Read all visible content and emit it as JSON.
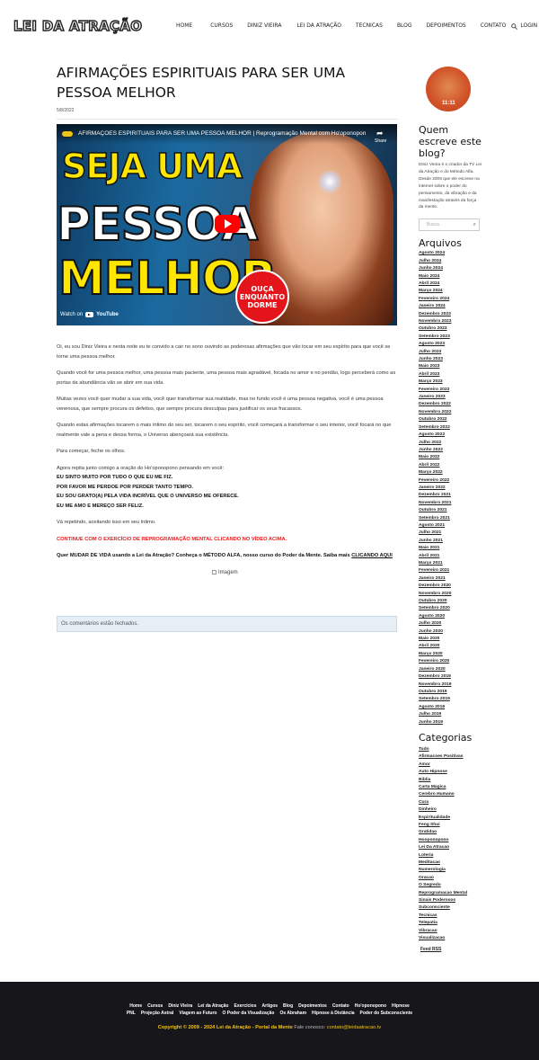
{
  "header": {
    "logo": "LEI DA ATRAÇÃO",
    "nav": [
      "HOME",
      "CURSOS",
      "DINIZ VIEIRA",
      "LEI DA ATRAÇÃO",
      "TECNICAS",
      "BLOG",
      "DEPOIMENTOS",
      "CONTATO",
      "LOGIN"
    ]
  },
  "post": {
    "title": "AFIRMAÇÕES ESPIRITUAIS PARA SER UMA PESSOA MELHOR",
    "date": "5/8/2022",
    "video": {
      "title": "AFIRMAÇÕES ESPIRITUAIS PARA SER UMA PESSOA MELHOR | Reprogramação Mental com Ho'oponopono ...",
      "share": "Share",
      "line1": "SEJA UMA",
      "line2": "PESSOA",
      "line3": "MELHOR",
      "badge1": "OUÇA",
      "badge2": "ENQUANTO",
      "badge3": "DORME",
      "watch_on": "Watch on",
      "youtube": "YouTube"
    },
    "paragraphs": [
      "Oi, eu sou Diniz Vieira e nesta noite eu te convido a cair no sono ouvindo as poderosas afirmações que vão tocar em seu espírito para que você se torne uma pessoa melhor.",
      "Quando você for uma pessoa melhor, uma pessoa mais paciente, uma pessoa mais agradável, focada no amor e no perdão, logo perceberá como as portas da abundância vão se abrir em sua vida.",
      "Muitas vezes você quer mudar a sua vida, você quer transformar sua realidade, mas no fundo você é uma pessoa negativa, você é uma pessoa venenosa, que sempre procura os defeitos, que sempre procura desculpas para justificar os seus fracassos.",
      "Quando estas afirmações tocarem o mais íntimo do seu ser, tocarem o seu espírito, você começará a transformar o seu interior, você focará no que realmente vale a pena e dessa forma, o Universo abençoará sua existência.",
      "Para começar, feche os olhos."
    ],
    "prayer_intro": "Agora repita junto comigo a oração do Ho'oponopono pensando em você:",
    "prayer": [
      "EU SINTO MUITO POR TUDO O QUE EU ME FIZ.",
      "POR FAVOR ME PERDOE POR PERDER TANTO TEMPO.",
      "EU SOU GRATO(A) PELA VIDA INCRÍVEL QUE O UNIVERSO ME OFERECE.",
      "EU ME AMO E MEREÇO SER FELIZ."
    ],
    "repeat": "Vá repetindo, aceitando isso em seu íntimo.",
    "continue": "CONTINUE COM O EXERCÍCIO DE REPROGRAMAÇÃO MENTAL CLICANDO NO VÍDEO ACIMA.",
    "cta_text": "Quer MUDAR DE VIDA usando a Lei da Atração? Conheça o MÉTODO ALFA, nosso curso do Poder da Mente. Saiba mais",
    "cta_link": "CLICANDO AQUI",
    "image_alt": "Imagem",
    "comments_closed": "Os comentários estão fechados."
  },
  "sidebar": {
    "avatar_text": "11:11",
    "about_title": "Quem escreve este blog?",
    "about_text": "Diniz Vieira é o criador da TV Lei da Atração e do Método Alfa. Desde 2009 que ele escreve na internet sobre o poder do pensamento, da vibração e da manifestação através da força da mente.",
    "search_placeholder": "Busca",
    "archives_title": "Arquivos",
    "archives": [
      "Agosto 2024",
      "Julho 2024",
      "Junho 2024",
      "Maio 2024",
      "Abril 2024",
      "Março 2024",
      "Fevereiro 2024",
      "Janeiro 2024",
      "Dezembro 2023",
      "Novembro 2023",
      "Outubro 2023",
      "Setembro 2023",
      "Agosto 2023",
      "Julho 2023",
      "Junho 2023",
      "Maio 2023",
      "Abril 2023",
      "Março 2023",
      "Fevereiro 2023",
      "Janeiro 2023",
      "Dezembro 2022",
      "Novembro 2022",
      "Outubro 2022",
      "Setembro 2022",
      "Agosto 2022",
      "Julho 2022",
      "Junho 2022",
      "Maio 2022",
      "Abril 2022",
      "Março 2022",
      "Fevereiro 2022",
      "Janeiro 2022",
      "Dezembro 2021",
      "Novembro 2021",
      "Outubro 2021",
      "Setembro 2021",
      "Agosto 2021",
      "Julho 2021",
      "Junho 2021",
      "Maio 2021",
      "Abril 2021",
      "Março 2021",
      "Fevereiro 2021",
      "Janeiro 2021",
      "Dezembro 2020",
      "Novembro 2020",
      "Outubro 2020",
      "Setembro 2020",
      "Agosto 2020",
      "Julho 2020",
      "Junho 2020",
      "Maio 2020",
      "Abril 2020",
      "Março 2020",
      "Fevereiro 2020",
      "Janeiro 2020",
      "Dezembro 2019",
      "Novembro 2019",
      "Outubro 2019",
      "Setembro 2019",
      "Agosto 2019",
      "Julho 2019",
      "Junho 2019"
    ],
    "categories_title": "Categorias",
    "categories": [
      "Tudo",
      "Afirmacoes Positivas",
      "Amor",
      "Auto Hipnose",
      "Biblia",
      "Carta Magica",
      "Cerebro Humano",
      "Cura",
      "Dinheiro",
      "Espiritualidade",
      "Feng Shui",
      "Gratidao",
      "Hooponopono",
      "Lei Da Atracao",
      "Loteria",
      "Meditacao",
      "Numerologia",
      "Oracao",
      "O Segredo",
      "Reprogramacao Mental",
      "Sinais Poderosos",
      "Subconsciente",
      "Tecnicas",
      "Telepatia",
      "Vibracao",
      "Visualizacao"
    ],
    "feed": "Feed RSS"
  },
  "footer": {
    "links1": [
      "Home",
      "Cursos",
      "Diniz Vieira",
      "Lei da Atração",
      "Exercícios",
      "Artigos",
      "Blog",
      "Depoimentos",
      "Contato",
      "Ho'oponopono",
      "Hipnose"
    ],
    "links2": [
      "PNL",
      "Projeção Astral",
      "Viagem ao Futuro",
      "O Poder da Visualização",
      "Os Abraham",
      "Hipnose à Distância",
      "Poder do Subconsciente"
    ],
    "copyright": "Copyright © 2009 - 2024 Lei da Atração - Portal da Mente",
    "contact_label": "Fale conosco:",
    "contact_email": "contato@leidaatracao.tv"
  }
}
